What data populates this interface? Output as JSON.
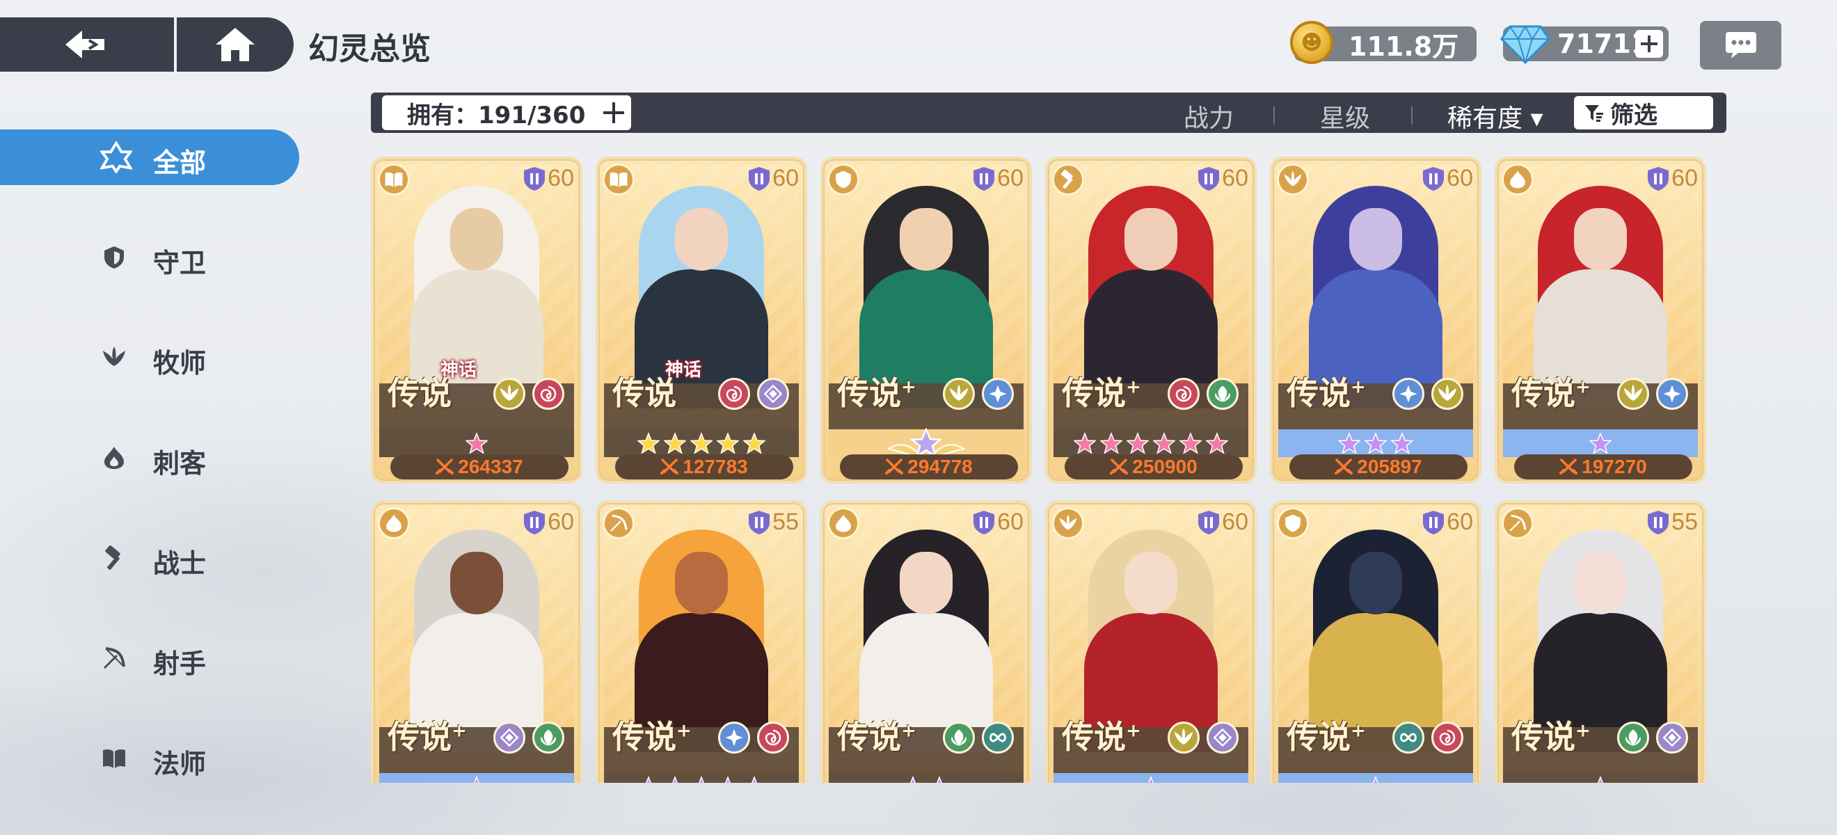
{
  "header": {
    "title": "幻灵总览",
    "gold": "111.8万",
    "gems": "71711"
  },
  "filter_bar": {
    "owned_label": "拥有：191/360",
    "sort_power": "战力",
    "sort_star": "星级",
    "sort_rarity": "稀有度 ▾",
    "filter_label": "筛选"
  },
  "sidebar": {
    "items": [
      {
        "label": "全部",
        "icon": "star-of-david-icon",
        "active": true
      },
      {
        "label": "守卫",
        "icon": "shield-icon",
        "active": false
      },
      {
        "label": "牧师",
        "icon": "wing-icon",
        "active": false
      },
      {
        "label": "刺客",
        "icon": "flame-icon",
        "active": false
      },
      {
        "label": "战士",
        "icon": "hammer-icon",
        "active": false
      },
      {
        "label": "射手",
        "icon": "bow-icon",
        "active": false
      },
      {
        "label": "法师",
        "icon": "book-icon",
        "active": false
      }
    ]
  },
  "colors": {
    "accent_blue": "#3a8fd8",
    "dark_bar": "#3b3e4a",
    "card_gold": "#f6d18c",
    "power_text": "#ff7a2c",
    "star_gold": "#ffd84a",
    "star_pink": "#f27aa6",
    "star_purple": "#c690f2"
  },
  "heroes": [
    {
      "class": "book-icon",
      "level": "60",
      "tag": "神话",
      "rarity": "传说",
      "plus": false,
      "elements": [
        "wing-icon",
        "swirl-icon"
      ],
      "star_type": "pink",
      "stars": 1,
      "star_band": "dark",
      "power": "264337",
      "hair": "#f4f1ec",
      "skin": "#e7cba5",
      "outfit": "#e9e2d2"
    },
    {
      "class": "book-icon",
      "level": "60",
      "tag": "神话",
      "rarity": "传说",
      "plus": false,
      "elements": [
        "swirl-icon",
        "diamond-icon"
      ],
      "star_type": "gold",
      "stars": 5,
      "star_band": "dark",
      "power": "127783",
      "hair": "#a9d6ee",
      "skin": "#f1d3bf",
      "outfit": "#2a3440"
    },
    {
      "class": "shield-icon",
      "level": "60",
      "tag": "",
      "rarity": "传说",
      "plus": true,
      "elements": [
        "wing-icon",
        "frost-icon"
      ],
      "star_type": "crown",
      "stars": 1,
      "star_band": "plain",
      "power": "294778",
      "hair": "#2b2a2f",
      "skin": "#f1cfb1",
      "outfit": "#1f7d63"
    },
    {
      "class": "hammer-icon",
      "level": "60",
      "tag": "",
      "rarity": "传说",
      "plus": true,
      "elements": [
        "swirl-icon",
        "leaf-icon"
      ],
      "star_type": "pink",
      "stars": 6,
      "star_band": "dark",
      "power": "250900",
      "hair": "#c9262b",
      "skin": "#f0cdb6",
      "outfit": "#2c2633"
    },
    {
      "class": "wing-icon",
      "level": "60",
      "tag": "",
      "rarity": "传说",
      "plus": true,
      "elements": [
        "frost-icon",
        "wing-icon"
      ],
      "star_type": "purple",
      "stars": 3,
      "star_band": "blue",
      "power": "205897",
      "hair": "#3e3f9d",
      "skin": "#c9bde6",
      "outfit": "#4b62c0"
    },
    {
      "class": "flame-icon",
      "level": "60",
      "tag": "",
      "rarity": "传说",
      "plus": true,
      "elements": [
        "wing-icon",
        "frost-icon"
      ],
      "star_type": "purple",
      "stars": 1,
      "star_band": "blue",
      "power": "197270",
      "hair": "#c8242b",
      "skin": "#f2d3bf",
      "outfit": "#e6dfd7"
    },
    {
      "class": "flame-icon",
      "level": "60",
      "tag": "",
      "rarity": "传说",
      "plus": true,
      "elements": [
        "diamond-icon",
        "leaf-icon"
      ],
      "star_type": "purple",
      "stars": 1,
      "star_band": "blue",
      "power": "",
      "hair": "#d8d3cc",
      "skin": "#7a5138",
      "outfit": "#f2efea"
    },
    {
      "class": "bow-icon",
      "level": "55",
      "tag": "",
      "rarity": "传说",
      "plus": true,
      "elements": [
        "frost-icon",
        "swirl-icon"
      ],
      "star_type": "purple",
      "stars": 5,
      "star_band": "dark",
      "power": "",
      "hair": "#f5a33a",
      "skin": "#b96a3f",
      "outfit": "#3a1c1c"
    },
    {
      "class": "flame-icon",
      "level": "60",
      "tag": "",
      "rarity": "传说",
      "plus": true,
      "elements": [
        "leaf-icon",
        "infinity-icon"
      ],
      "star_type": "purple",
      "stars": 2,
      "star_band": "dark",
      "power": "",
      "hair": "#262228",
      "skin": "#f3d7c5",
      "outfit": "#f2eeea"
    },
    {
      "class": "wing-icon",
      "level": "60",
      "tag": "",
      "rarity": "传说",
      "plus": true,
      "elements": [
        "wing-icon",
        "diamond-icon"
      ],
      "star_type": "purple",
      "stars": 1,
      "star_band": "blue",
      "power": "",
      "hair": "#ead3a0",
      "skin": "#f4dccb",
      "outfit": "#b4222b"
    },
    {
      "class": "shield-icon",
      "level": "60",
      "tag": "",
      "rarity": "传说",
      "plus": true,
      "elements": [
        "infinity-icon",
        "swirl-icon"
      ],
      "star_type": "purple",
      "stars": 1,
      "star_band": "blue",
      "power": "",
      "hair": "#1c2233",
      "skin": "#2f3b57",
      "outfit": "#d8b24c"
    },
    {
      "class": "bow-icon",
      "level": "55",
      "tag": "",
      "rarity": "传说",
      "plus": true,
      "elements": [
        "leaf-icon",
        "diamond-icon"
      ],
      "star_type": "purple",
      "stars": 1,
      "star_band": "dark",
      "power": "",
      "hair": "#e4e4e6",
      "skin": "#f3dfd8",
      "outfit": "#25222a"
    }
  ]
}
